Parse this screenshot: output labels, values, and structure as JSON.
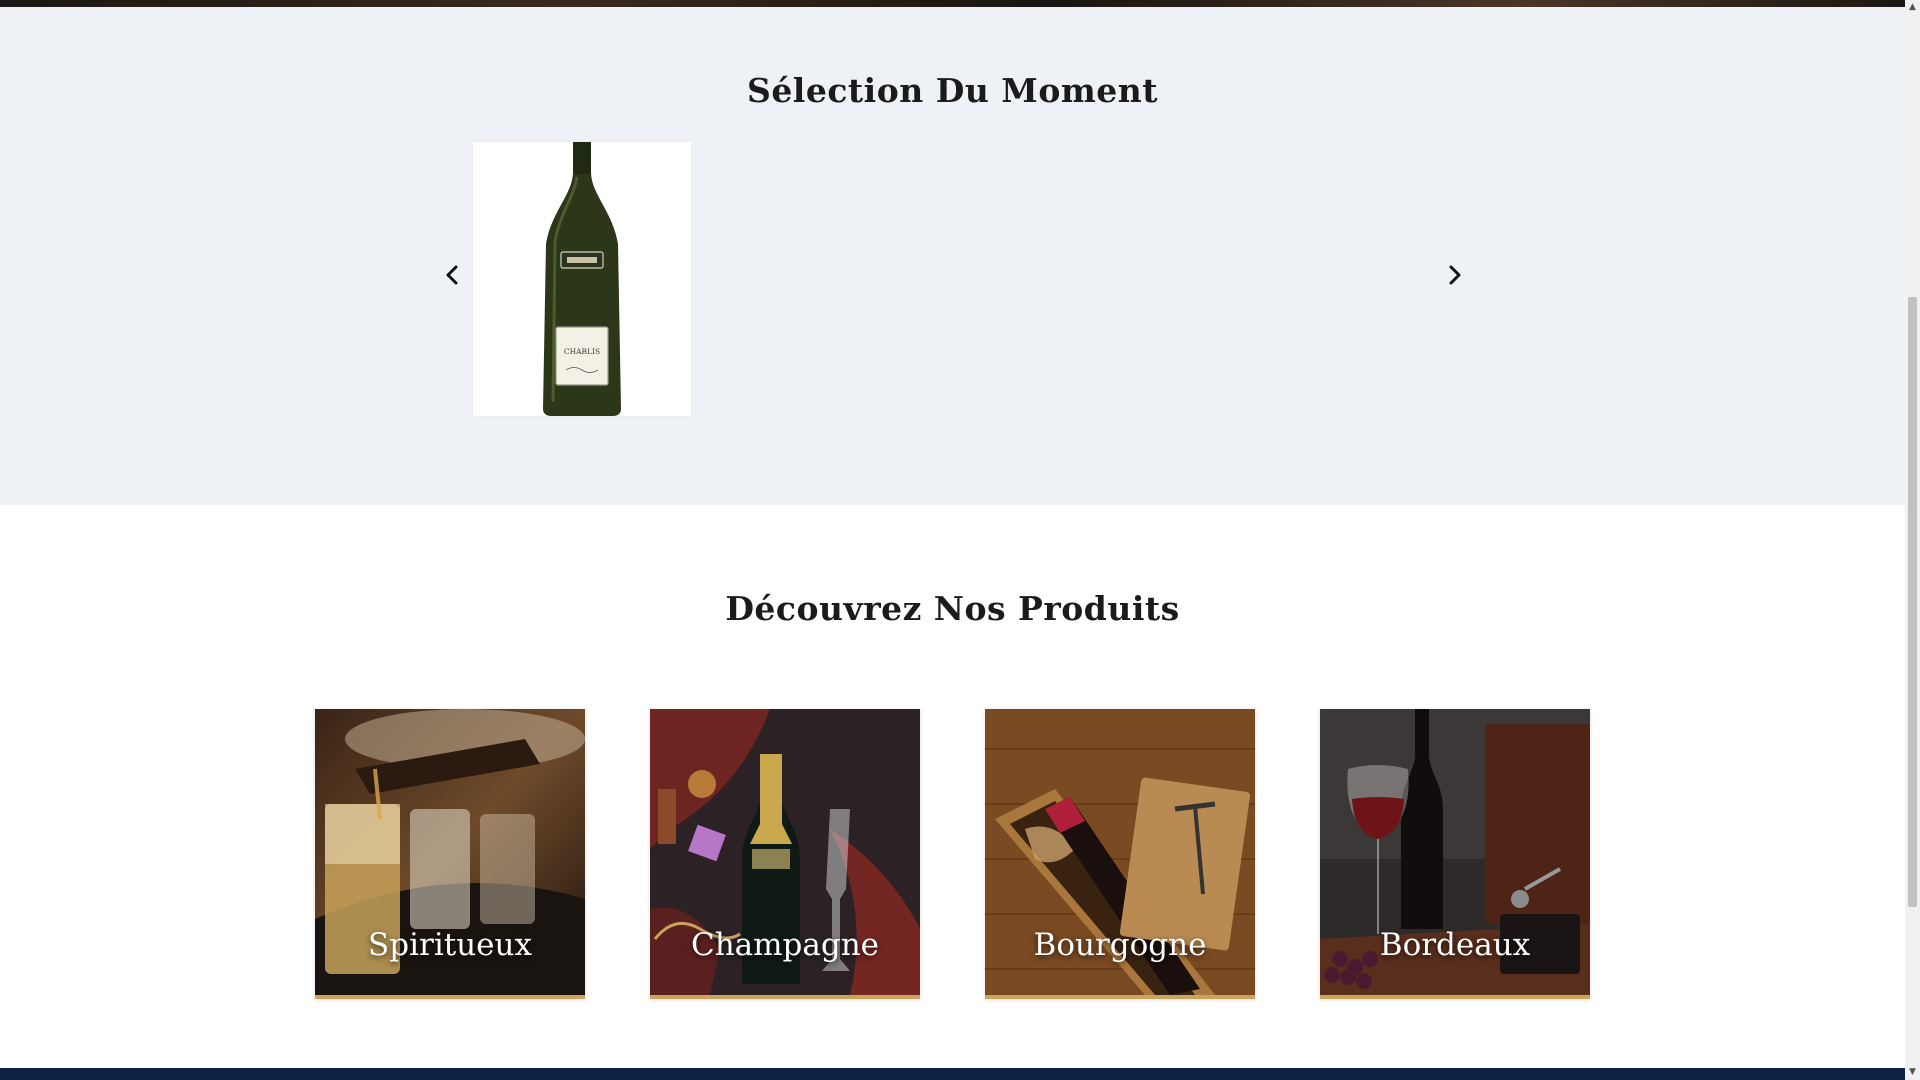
{
  "selection": {
    "title": "Sélection Du Moment",
    "prev_icon": "chevron-left-icon",
    "next_icon": "chevron-right-icon",
    "products": [
      {
        "label_text": "CHABLIS",
        "image": "white-wine-bottle"
      }
    ]
  },
  "products": {
    "title": "Découvrez Nos Produits",
    "categories": [
      {
        "label": "Spiritueux",
        "image": "whisky-glasses"
      },
      {
        "label": "Champagne",
        "image": "champagne-bottle"
      },
      {
        "label": "Bourgogne",
        "image": "wine-in-wooden-box"
      },
      {
        "label": "Bordeaux",
        "image": "red-wine-glass-bottle"
      }
    ]
  },
  "colors": {
    "section_bg": "#eef1f5",
    "accent_gold": "#c9a45c",
    "footer_navy": "#0e2444"
  }
}
